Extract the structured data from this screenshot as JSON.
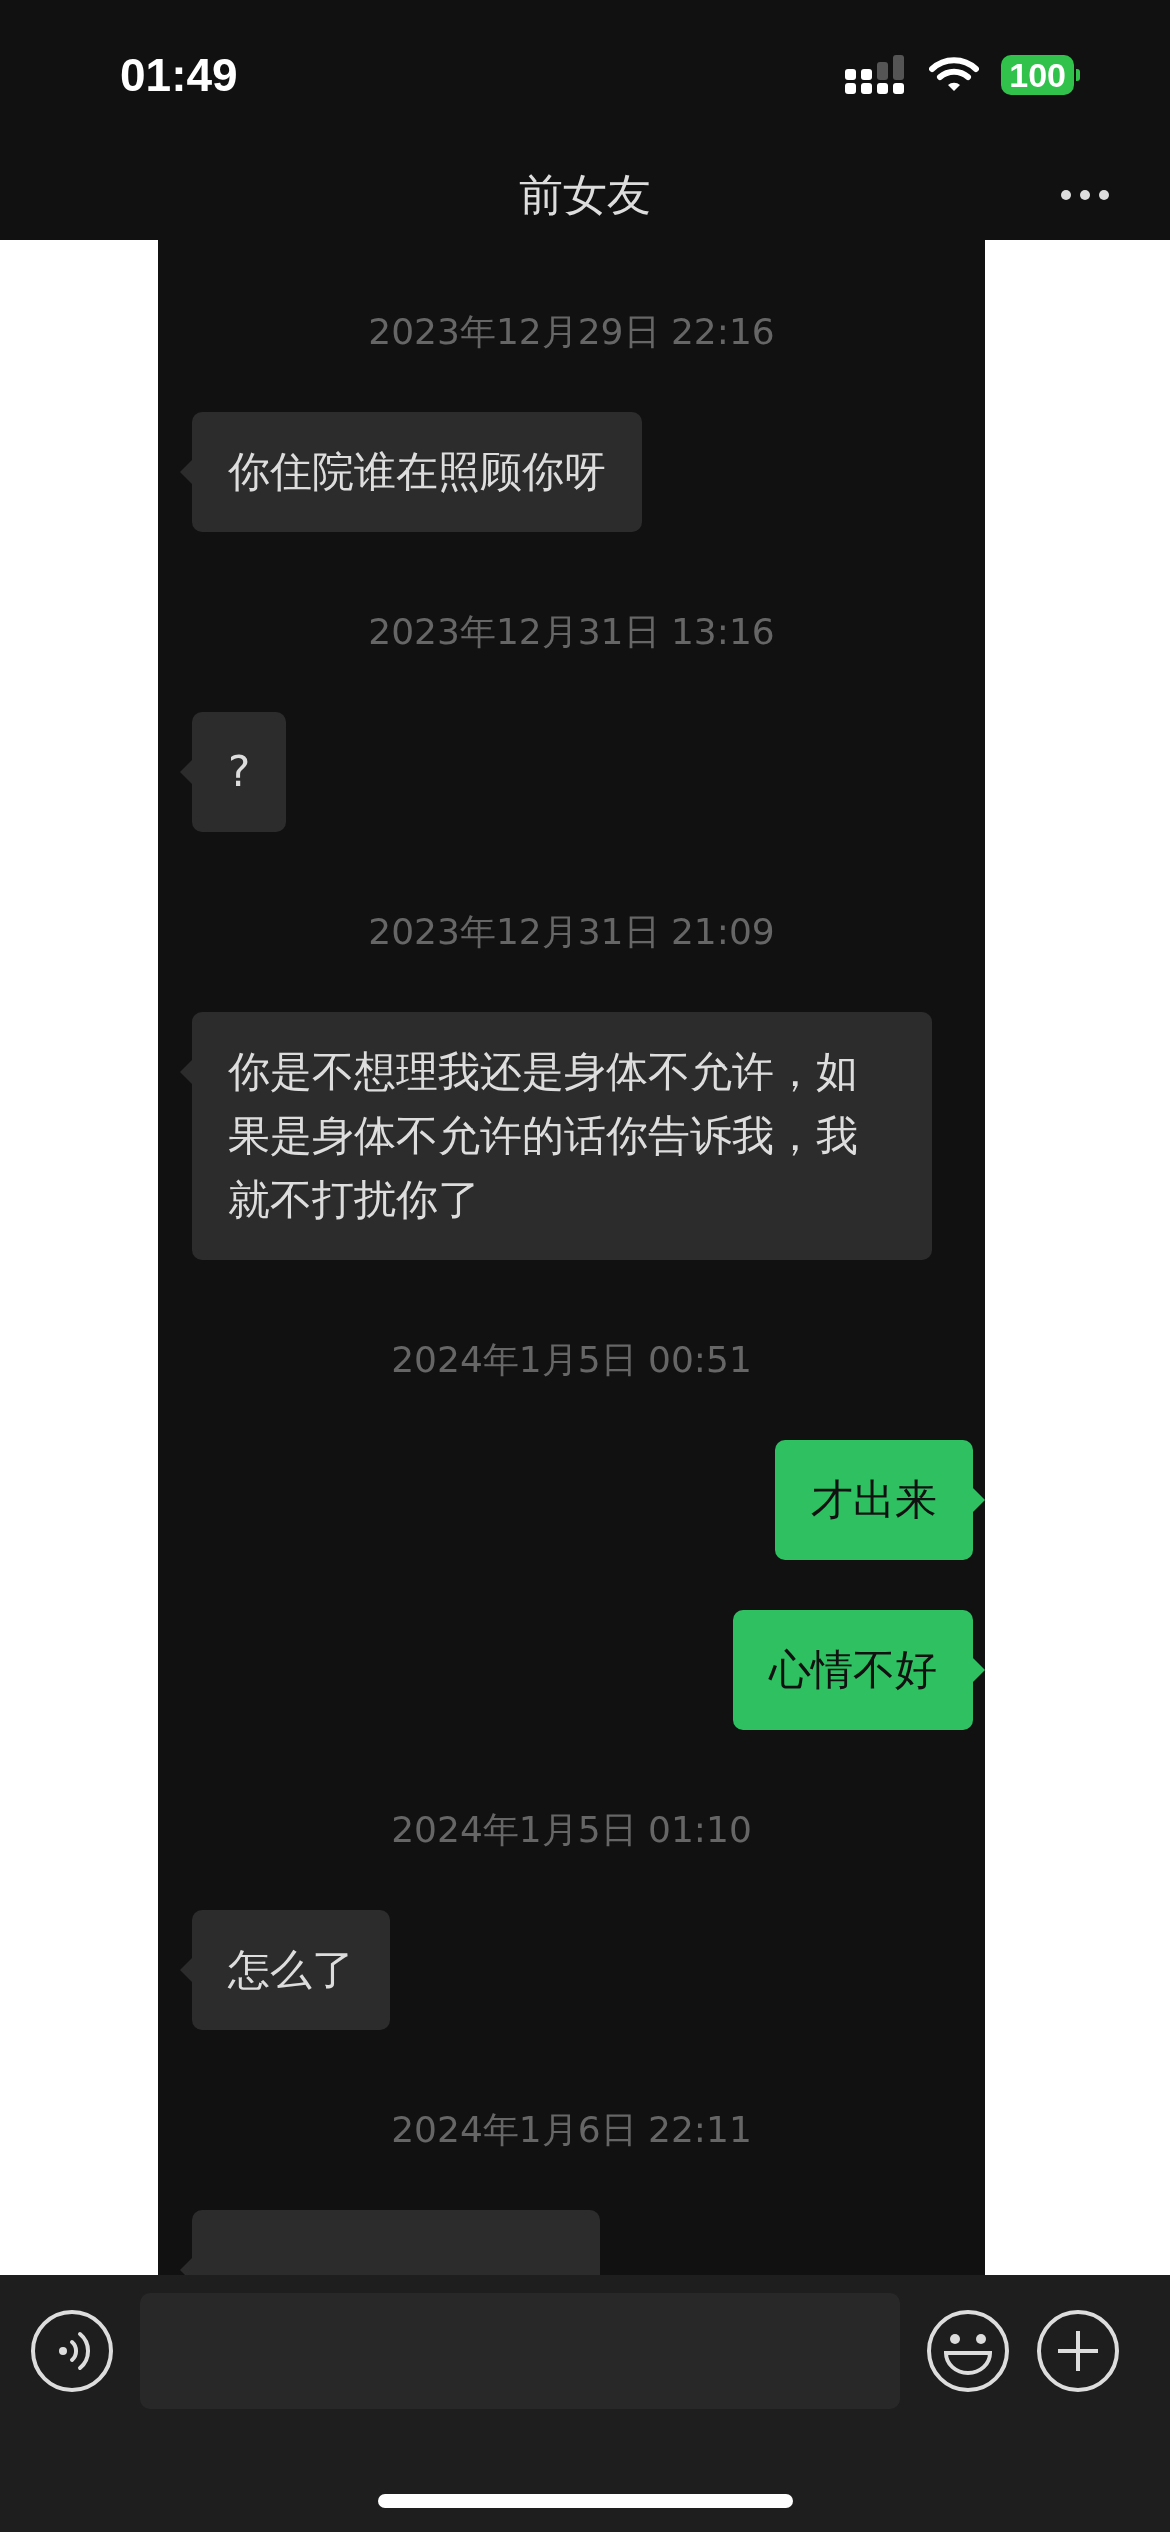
{
  "status_bar": {
    "time": "01:49",
    "battery": "100"
  },
  "title": "前女友",
  "messages": [
    {
      "kind": "time",
      "text": "2023年12月29日 22:16"
    },
    {
      "kind": "received",
      "text": "你住院谁在照顾你呀"
    },
    {
      "kind": "time",
      "text": "2023年12月31日 13:16"
    },
    {
      "kind": "received",
      "text": "?"
    },
    {
      "kind": "time",
      "text": "2023年12月31日 21:09"
    },
    {
      "kind": "received",
      "text": "你是不想理我还是身体不允许，如果是身体不允许的话你告诉我，我就不打扰你了"
    },
    {
      "kind": "time",
      "text": "2024年1月5日 00:51"
    },
    {
      "kind": "sent",
      "text": "才出来"
    },
    {
      "kind": "sent",
      "text": "心情不好"
    },
    {
      "kind": "time",
      "text": "2024年1月5日 01:10"
    },
    {
      "kind": "received",
      "text": "怎么了"
    },
    {
      "kind": "time",
      "text": "2024年1月6日 22:11"
    },
    {
      "kind": "received_cut"
    }
  ]
}
